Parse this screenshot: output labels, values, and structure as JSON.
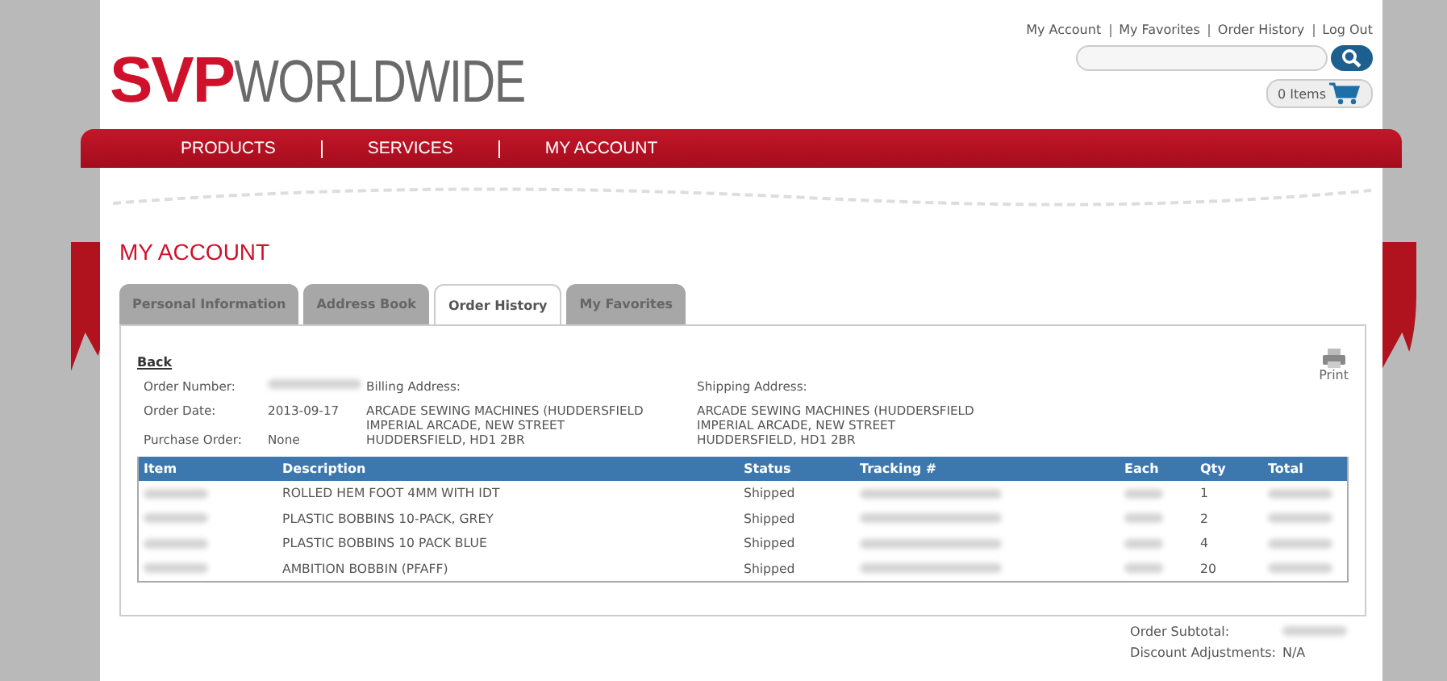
{
  "logo": {
    "brand": "SVP",
    "suffix": "WORLDWIDE"
  },
  "top_links": [
    "My Account",
    "My Favorites",
    "Order History",
    "Log Out"
  ],
  "cart": {
    "label": "0 Items"
  },
  "nav": [
    "PRODUCTS",
    "SERVICES",
    "MY ACCOUNT"
  ],
  "page_title": "MY ACCOUNT",
  "tabs": [
    {
      "label": "Personal Information",
      "selected": false
    },
    {
      "label": "Address Book",
      "selected": false
    },
    {
      "label": "Order History",
      "selected": true
    },
    {
      "label": "My Favorites",
      "selected": false
    }
  ],
  "back_link": "Back",
  "print": {
    "label": "Print"
  },
  "order": {
    "number_label": "Order Number:",
    "date_label": "Order Date:",
    "date": "2013-09-17",
    "po_label": "Purchase Order:",
    "po": "None",
    "billing_label": "Billing Address:",
    "billing": [
      "ARCADE SEWING MACHINES (HUDDERSFIELD",
      "IMPERIAL ARCADE, NEW STREET",
      "HUDDERSFIELD, HD1 2BR"
    ],
    "shipping_label": "Shipping Address:",
    "shipping": [
      "ARCADE SEWING MACHINES (HUDDERSFIELD",
      "IMPERIAL ARCADE, NEW STREET",
      "HUDDERSFIELD, HD1 2BR"
    ]
  },
  "table": {
    "columns": [
      "Item",
      "Description",
      "Status",
      "Tracking #",
      "Each",
      "Qty",
      "Total"
    ],
    "rows": [
      {
        "description": "ROLLED HEM FOOT 4MM WITH IDT",
        "status": "Shipped",
        "qty": "1"
      },
      {
        "description": "PLASTIC BOBBINS 10-PACK, GREY",
        "status": "Shipped",
        "qty": "2"
      },
      {
        "description": "PLASTIC BOBBINS 10 PACK BLUE",
        "status": "Shipped",
        "qty": "4"
      },
      {
        "description": "AMBITION BOBBIN (PFAFF)",
        "status": "Shipped",
        "qty": "20"
      }
    ]
  },
  "totals": [
    {
      "label": "Order Subtotal:"
    },
    {
      "label": "Discount Adjustments:",
      "value": "N/A"
    }
  ]
}
